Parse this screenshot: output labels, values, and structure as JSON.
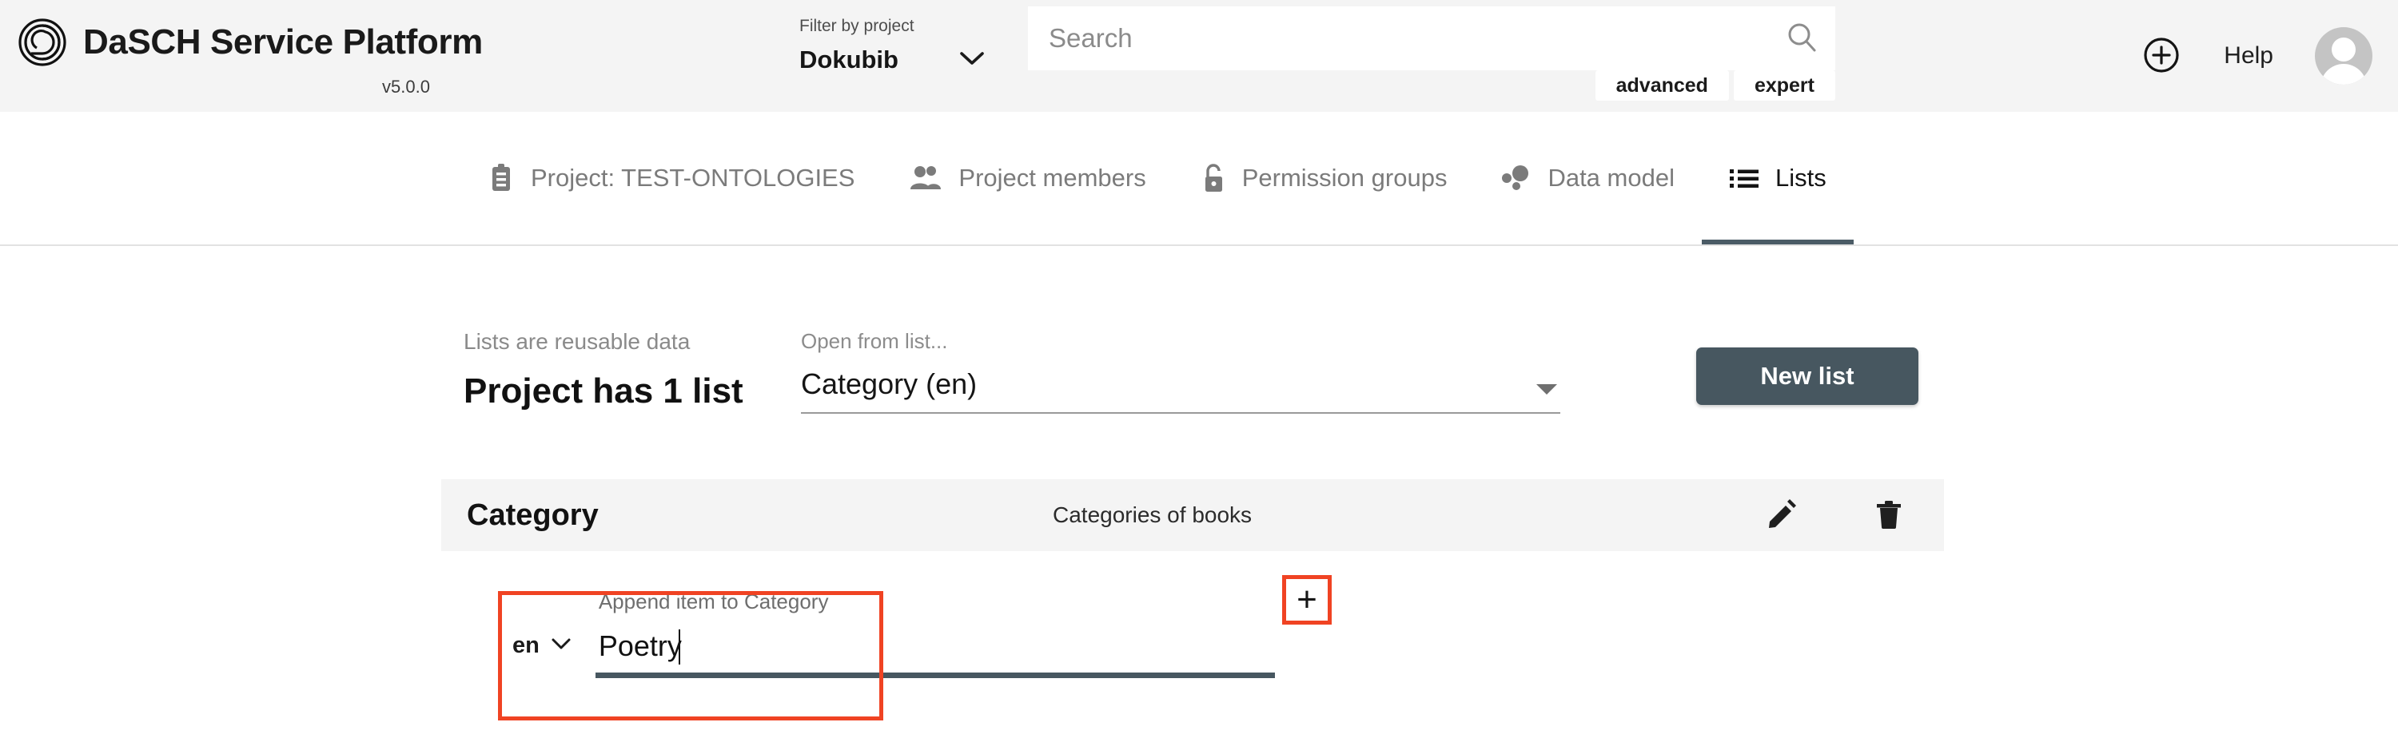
{
  "app": {
    "title": "DaSCH Service Platform",
    "version": "v5.0.0",
    "logo_icon": "dasch-spiral-logo-icon"
  },
  "header": {
    "filter": {
      "label": "Filter by project",
      "value": "Dokubib",
      "chevron_icon": "chevron-down-icon"
    },
    "search": {
      "value": "",
      "placeholder": "Search",
      "icon": "search-icon"
    },
    "search_modes": [
      {
        "label": "advanced",
        "name": "advanced-search-button"
      },
      {
        "label": "expert",
        "name": "expert-search-button"
      }
    ],
    "actions": {
      "add_icon": "plus-circle-icon",
      "help_label": "Help",
      "avatar_icon": "user-avatar-icon"
    }
  },
  "tabs": [
    {
      "label": "Project: TEST-ONTOLOGIES",
      "icon": "clipboard-icon",
      "active": false
    },
    {
      "label": "Project members",
      "icon": "people-icon",
      "active": false
    },
    {
      "label": "Permission groups",
      "icon": "unlock-icon",
      "active": false
    },
    {
      "label": "Data model",
      "icon": "data-model-bubbles-icon",
      "active": false
    },
    {
      "label": "Lists",
      "icon": "list-bullet-icon",
      "active": true
    }
  ],
  "main": {
    "intro": {
      "subtitle": "Lists are reusable data",
      "title": "Project has 1 list"
    },
    "open_from_list": {
      "label": "Open from list...",
      "value": "Category (en)",
      "arrow_icon": "triangle-down-icon"
    },
    "new_list_button": "New list",
    "panel": {
      "name": "Category",
      "comment": "Categories of books",
      "edit_icon": "pencil-edit-icon",
      "delete_icon": "trash-delete-icon"
    },
    "append_form": {
      "language": "en",
      "language_chevron_icon": "chevron-down-icon",
      "label": "Append item to Category",
      "value": "Poetry",
      "placeholder": "",
      "add_button_icon": "plus-icon",
      "add_button_glyph": "+"
    }
  },
  "colors": {
    "accent_dark": "#475760",
    "highlight_red": "#f04323",
    "header_bg": "#f4f4f4",
    "panel_bg": "#f4f4f4",
    "muted_text": "#7b7b7b"
  }
}
